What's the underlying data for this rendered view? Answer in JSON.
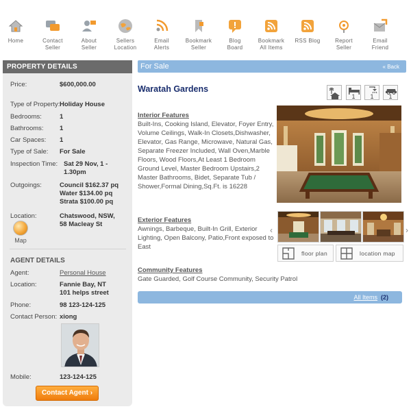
{
  "toolbar": {
    "items": [
      {
        "label": "Home",
        "icon": "home-icon"
      },
      {
        "label": "Contact\nSeller",
        "icon": "chat-icon"
      },
      {
        "label": "About\nSeller",
        "icon": "user-icon"
      },
      {
        "label": "Sellers\nLocation",
        "icon": "globe-icon"
      },
      {
        "label": "Email\nAlerts",
        "icon": "rss-alert-icon"
      },
      {
        "label": "Bookmark\nSeller",
        "icon": "bookmark-icon"
      },
      {
        "label": "Blog\nBoard",
        "icon": "blog-icon"
      },
      {
        "label": "Bookmark\nAll Items",
        "icon": "rss-icon"
      },
      {
        "label": "RSS Blog",
        "icon": "rss-icon"
      },
      {
        "label": "Report\nSeller",
        "icon": "report-icon"
      },
      {
        "label": "Email\nFriend",
        "icon": "email-icon"
      }
    ]
  },
  "sidebar": {
    "header": "PROPERTY DETAILS",
    "price_label": "Price:",
    "price": "$600,000.00",
    "type_label": "Type of Property:",
    "type": "Holiday House",
    "bedrooms_label": "Bedrooms:",
    "bedrooms": "1",
    "bathrooms_label": "Bathrooms:",
    "bathrooms": "1",
    "car_label": "Car Spaces:",
    "car": "1",
    "sale_label": "Type of Sale:",
    "sale": "For Sale",
    "inspection_label": "Inspection Time:",
    "inspection": "Sat 29 Nov, 1 - 1.30pm",
    "outgoings_label": "Outgoings:",
    "outgoings": [
      "Council $162.37 pq",
      "Water $134.00 pq",
      "Strata $100.00 pq"
    ],
    "location_label": "Location:",
    "location": "Chatswood, NSW, 58 Macleay St",
    "map_label": "Map",
    "agent_header": "AGENT DETAILS",
    "agent_label": "Agent:",
    "agent": "Personal House",
    "agent_location_label": "Location:",
    "agent_location": "Fannie Bay, NT 101 helps street",
    "phone_label": "Phone:",
    "phone": "98 123-124-125",
    "contact_label": "Contact Person:",
    "contact": "xiong",
    "mobile_label": "Mobile:",
    "mobile": "123-124-125",
    "contact_button": "Contact Agent"
  },
  "main": {
    "status": "For Sale",
    "back": "« Back",
    "title": "Waratah Gardens",
    "amenities": [
      {
        "icon": "property-type-icon",
        "count": ""
      },
      {
        "icon": "bed-icon",
        "count": "1"
      },
      {
        "icon": "shower-icon",
        "count": "1"
      },
      {
        "icon": "car-icon",
        "count": "1"
      }
    ],
    "interior_title": "Interior Features",
    "interior_text": "Built-Ins, Cooking Island, Elevator, Foyer Entry, Volume Ceilings, Walk-In Closets,Dishwasher, Elevator, Gas Range, Microwave, Natural Gas, Separate Freezer Included, Wall Oven,Marble Floors, Wood Floors,At Least 1 Bedroom Ground Level, Master Bedroom Upstairs,2 Master Bathrooms, Bidet, Separate Tub / Shower,Formal Dining,Sq.Ft. is 16228",
    "exterior_title": "Exterior Features",
    "exterior_text": "Awnings, Barbeque, Built-In Grill, Exterior Lighting, Open Balcony, Patio,Front exposed to East",
    "community_title": "Community Features",
    "community_text": "Gate Guarded, Golf Course Community, Security Patrol",
    "floor_plan": "floor plan",
    "location_map": "location map",
    "all_items": "All Items",
    "all_items_count": "(2)"
  },
  "colors": {
    "blue_bar": "#8db7df",
    "title_navy": "#1a2e6e",
    "sidebar_header": "#6b6b6b",
    "button_orange": "#ef7c0c"
  }
}
